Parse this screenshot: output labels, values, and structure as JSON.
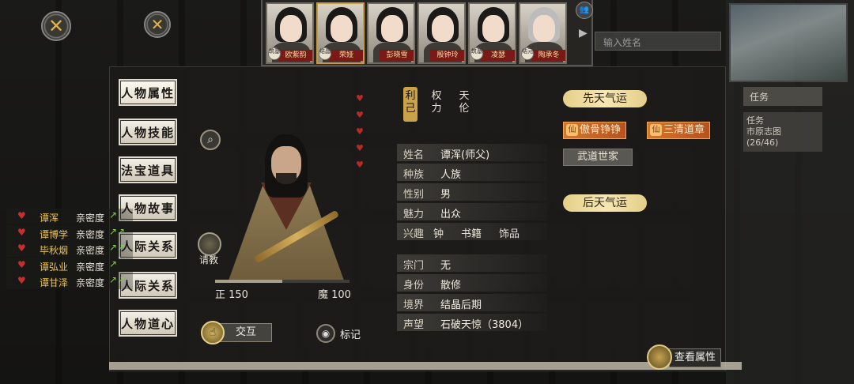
{
  "strip": {
    "characters": [
      {
        "name": "欧紫韵",
        "seal": "筑基",
        "hair": "dark"
      },
      {
        "name": "荣娅",
        "seal": "结晶",
        "hair": "dark",
        "selected": true
      },
      {
        "name": "彭晓雪",
        "seal": "",
        "hair": "dark"
      },
      {
        "name": "殷钟玲",
        "seal": "",
        "hair": "dark"
      },
      {
        "name": "凌瑟",
        "seal": "筑基",
        "hair": "dark"
      },
      {
        "name": "陶承冬",
        "seal": "结元",
        "hair": "grey"
      }
    ]
  },
  "background": {
    "search_placeholder": "输入姓名",
    "task_label": "任务",
    "side_text": "任务\n市原志图\n(26/46)"
  },
  "tabs": [
    {
      "label": "人物属性",
      "active": true
    },
    {
      "label": "人物技能"
    },
    {
      "label": "法宝道具"
    },
    {
      "label": "人物故事"
    },
    {
      "label": "人际关系"
    },
    {
      "label": "人际关系"
    },
    {
      "label": "人物道心"
    }
  ],
  "affinity": {
    "label": "亲密度",
    "items": [
      {
        "name": "谭浑",
        "arrows": "↗"
      },
      {
        "name": "谭博学",
        "arrows": "↗↗"
      },
      {
        "name": "毕秋烟",
        "arrows": "↗↗"
      },
      {
        "name": "谭弘业",
        "arrows": "↗"
      },
      {
        "name": "谭甘泽",
        "arrows": "↗↗"
      }
    ]
  },
  "character": {
    "ask_label": "请教",
    "righteous_label": "正 150",
    "demonic_label": "魔 100",
    "righteous_value": 150,
    "demonic_value": 100,
    "interact_label": "交互",
    "mark_label": "标记"
  },
  "vtabs": [
    {
      "line1": "利",
      "line2": "己",
      "active": true
    },
    {
      "line1": "权",
      "line2": "力"
    },
    {
      "line1": "天",
      "line2": "伦"
    }
  ],
  "info": {
    "name": {
      "k": "姓名",
      "v": "谭浑(师父)"
    },
    "race": {
      "k": "种族",
      "v": "人族"
    },
    "gender": {
      "k": "性别",
      "v": "男"
    },
    "charm": {
      "k": "魅力",
      "v": "出众"
    },
    "hobby": {
      "k": "兴趣",
      "items": [
        "钟",
        "书籍",
        "饰品"
      ]
    },
    "sect": {
      "k": "宗门",
      "v": "无"
    },
    "identity": {
      "k": "身份",
      "v": "散修"
    },
    "realm": {
      "k": "境界",
      "v": "结晶后期"
    },
    "reputation": {
      "k": "声望",
      "v": "石破天惊（3804）"
    }
  },
  "fortune": {
    "innate_title": "先天气运",
    "innate": [
      "傲骨铮铮",
      "三清道章"
    ],
    "innate_plain": "武道世家",
    "acquired_title": "后天气运",
    "gold_mark": "仙"
  },
  "view_attr_label": "查看属性",
  "hearts_count": 5,
  "colors": {
    "accent_gold": "#c9a24a",
    "heart_red": "#c43030",
    "arrow_green": "#7fd04a"
  }
}
